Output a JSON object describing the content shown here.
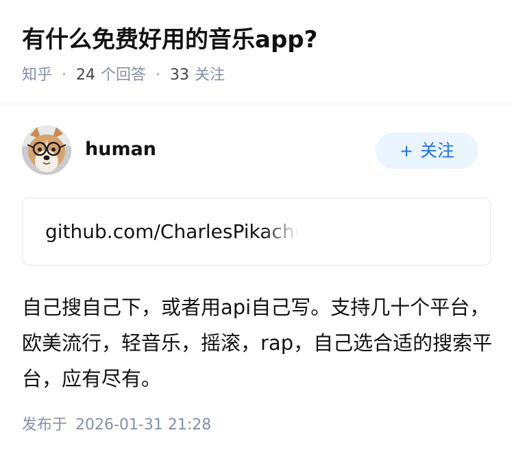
{
  "question": {
    "title": "有什么免费好用的音乐app?",
    "source": "知乎",
    "answer_count": "24",
    "answer_label": "个回答",
    "follower_count": "33",
    "follower_label": "关注"
  },
  "answer": {
    "author": {
      "name": "human",
      "avatar_icon": "corgi-with-glasses-avatar"
    },
    "follow_button": {
      "icon": "plus-icon",
      "label": "关注"
    },
    "link_card": {
      "text": "github.com/CharlesPikachu"
    },
    "content": "自己搜自己下，或者用api自己写。支持几十个平台，欧美流行，轻音乐，摇滚，rap，自己选合适的搜索平台，应有尽有。",
    "publish": {
      "label": "发布于",
      "time": "2026-01-31 21:28"
    }
  },
  "colors": {
    "accent": "#1772f6",
    "accent_bg": "#ebf5ff",
    "meta": "#8590a6",
    "text": "#121212"
  }
}
